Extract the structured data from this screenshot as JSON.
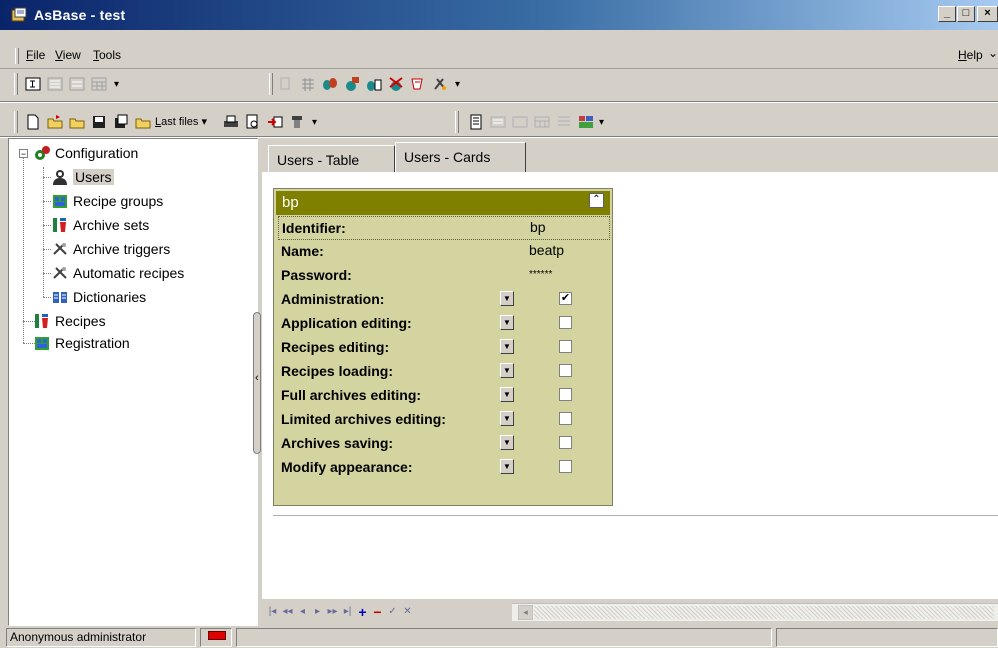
{
  "window": {
    "title": "AsBase - test",
    "controls": [
      "_",
      "□",
      "×"
    ]
  },
  "menubar": {
    "items": [
      {
        "label": "File",
        "accel": "F",
        "rest": "ile"
      },
      {
        "label": "View",
        "accel": "V",
        "rest": "iew"
      },
      {
        "label": "Tools",
        "accel": "T",
        "rest": "ools"
      }
    ],
    "help": {
      "label": "Help",
      "accel": "H",
      "rest": "elp"
    }
  },
  "toolbar": {
    "last_files_label": "Last files",
    "last_files_accel": "L",
    "last_files_rest": "ast files"
  },
  "tree": {
    "items": [
      {
        "label": "Configuration",
        "icon": "configuration-icon"
      },
      {
        "label": "Users",
        "icon": "users-icon",
        "selected": true
      },
      {
        "label": "Recipe groups",
        "icon": "recipe-groups-icon"
      },
      {
        "label": "Archive sets",
        "icon": "archive-sets-icon"
      },
      {
        "label": "Archive triggers",
        "icon": "archive-triggers-icon"
      },
      {
        "label": "Automatic recipes",
        "icon": "automatic-recipes-icon"
      },
      {
        "label": "Dictionaries",
        "icon": "dictionaries-icon"
      },
      {
        "label": "Recipes",
        "icon": "recipes-icon"
      },
      {
        "label": "Registration",
        "icon": "registration-icon"
      }
    ]
  },
  "tabs": [
    {
      "label": "Users - Table",
      "active": false
    },
    {
      "label": "Users - Cards",
      "active": true
    }
  ],
  "card": {
    "header": "bp",
    "fields": [
      {
        "label": "Identifier:",
        "value": "bp"
      },
      {
        "label": "Name:",
        "value": "beatp"
      },
      {
        "label": "Password:",
        "value": "******"
      }
    ],
    "permissions": [
      {
        "label": "Administration:",
        "checked": true
      },
      {
        "label": "Application editing:",
        "checked": false
      },
      {
        "label": "Recipes editing:",
        "checked": false
      },
      {
        "label": "Recipes loading:",
        "checked": false
      },
      {
        "label": "Full archives editing:",
        "checked": false
      },
      {
        "label": "Limited archives editing:",
        "checked": false
      },
      {
        "label": "Archives saving:",
        "checked": false
      },
      {
        "label": "Modify appearance:",
        "checked": false
      }
    ],
    "check_mark": "✔"
  },
  "statusbar": {
    "user": "Anonymous administrator"
  },
  "colors": {
    "card_bg": "#d4d4a0",
    "card_header": "#808000",
    "title_start": "#0a246a",
    "title_end": "#a6caf0"
  }
}
